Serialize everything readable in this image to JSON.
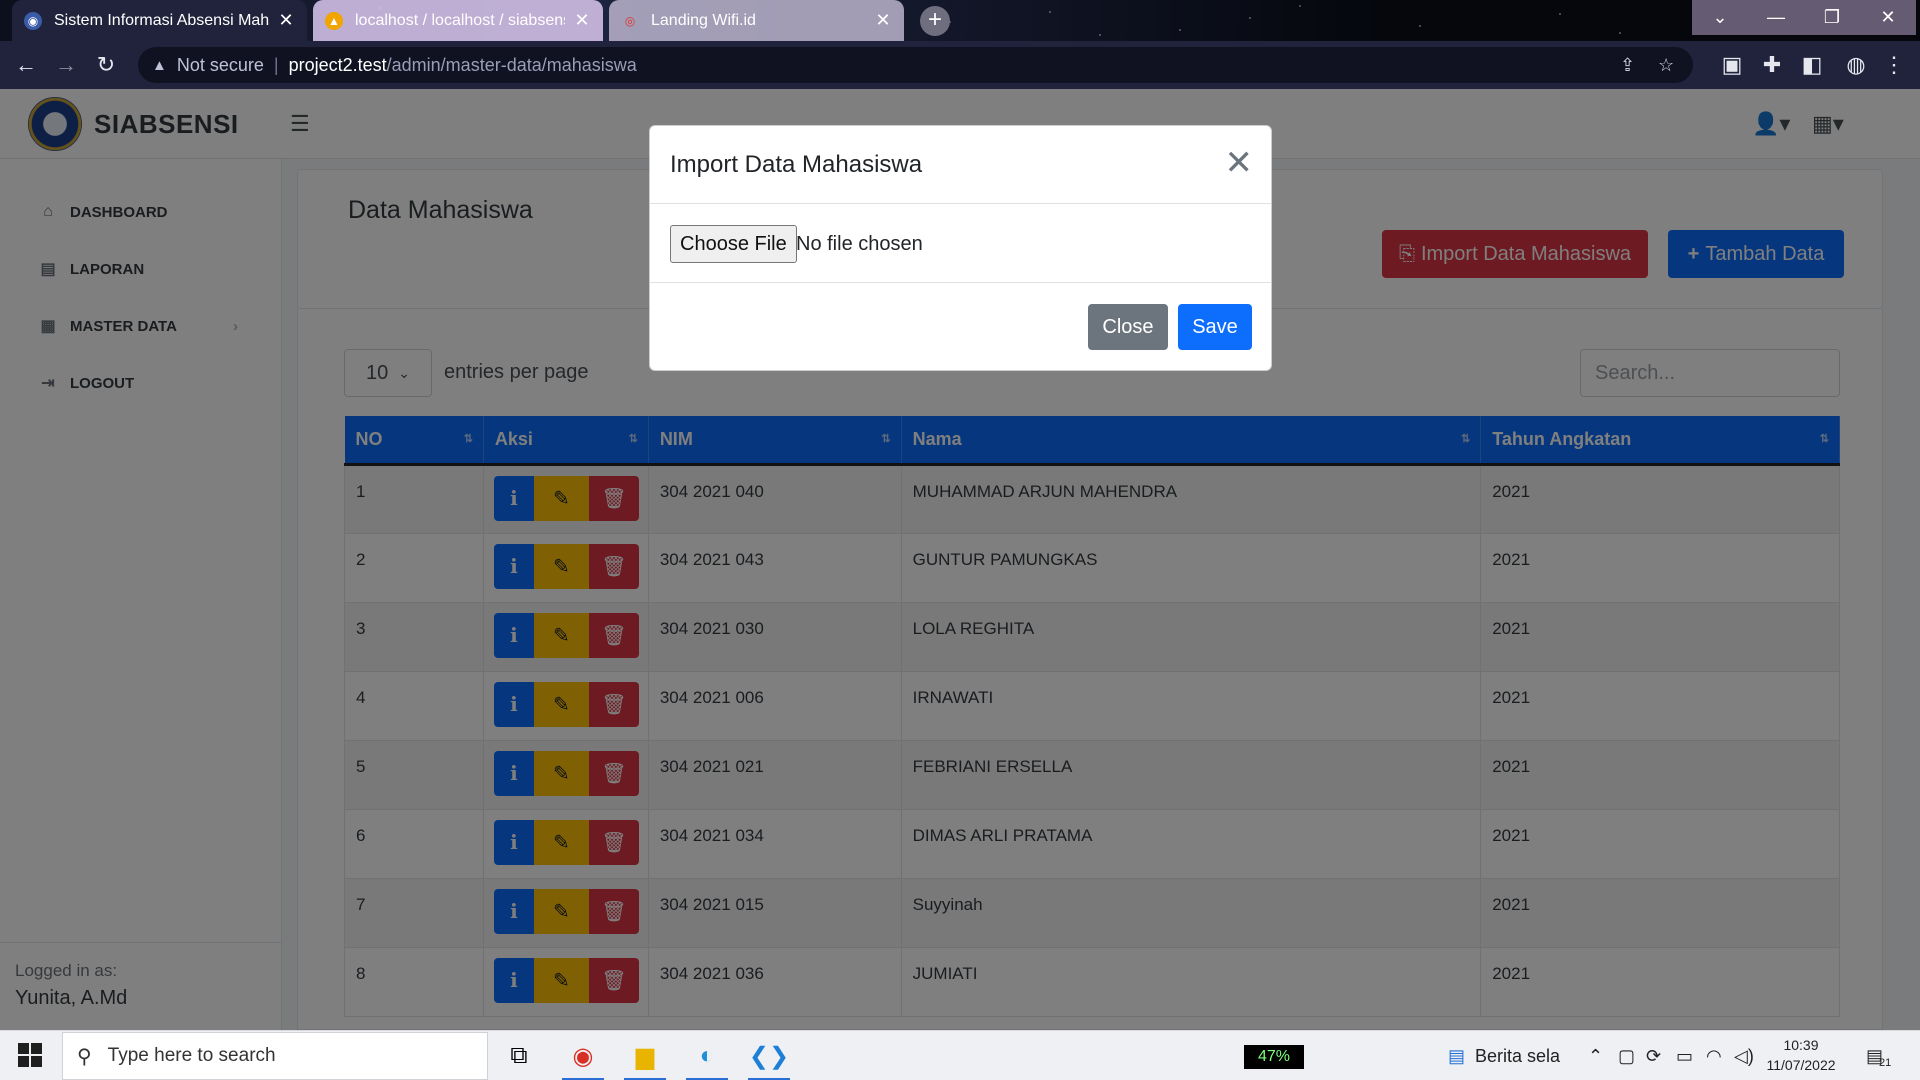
{
  "browser": {
    "tabs": [
      {
        "title": "Sistem Informasi Absensi Mahasi"
      },
      {
        "title": "localhost / localhost / siabsensi"
      },
      {
        "title": "Landing Wifi.id"
      }
    ],
    "address": {
      "security": "Not secure",
      "host": "project2.test",
      "path": "/admin/master-data/mahasiswa"
    }
  },
  "app": {
    "brand": "SIABSENSI",
    "sidebar": {
      "items": [
        {
          "label": "DASHBOARD",
          "icon": "home-icon"
        },
        {
          "label": "LAPORAN",
          "icon": "report-icon"
        },
        {
          "label": "MASTER DATA",
          "icon": "table-icon"
        },
        {
          "label": "LOGOUT",
          "icon": "logout-icon"
        }
      ],
      "footer": {
        "label": "Logged in as:",
        "user": "Yunita, A.Md"
      }
    },
    "page_title": "Data Mahasiswa",
    "buttons": {
      "import": "Import Data Mahasiswa",
      "add": "Tambah Data"
    },
    "table": {
      "per_page": "10",
      "per_page_label": "entries per page",
      "search_placeholder": "Search...",
      "columns": [
        "NO",
        "Aksi",
        "NIM",
        "Nama",
        "Tahun Angkatan"
      ],
      "rows": [
        {
          "no": "1",
          "nim": "304 2021 040",
          "nama": "MUHAMMAD ARJUN MAHENDRA",
          "tahun": "2021"
        },
        {
          "no": "2",
          "nim": "304 2021 043",
          "nama": "GUNTUR PAMUNGKAS",
          "tahun": "2021"
        },
        {
          "no": "3",
          "nim": "304 2021 030",
          "nama": "LOLA REGHITA",
          "tahun": "2021"
        },
        {
          "no": "4",
          "nim": "304 2021 006",
          "nama": "IRNAWATI",
          "tahun": "2021"
        },
        {
          "no": "5",
          "nim": "304 2021 021",
          "nama": "FEBRIANI ERSELLA",
          "tahun": "2021"
        },
        {
          "no": "6",
          "nim": "304 2021 034",
          "nama": "DIMAS ARLI PRATAMA",
          "tahun": "2021"
        },
        {
          "no": "7",
          "nim": "304 2021 015",
          "nama": "Suyyinah",
          "tahun": "2021"
        },
        {
          "no": "8",
          "nim": "304 2021 036",
          "nama": "JUMIATI",
          "tahun": "2021"
        }
      ]
    }
  },
  "modal": {
    "title": "Import Data Mahasiswa",
    "file_button": "Choose File",
    "file_status": "No file chosen",
    "close_label": "Close",
    "save_label": "Save"
  },
  "taskbar": {
    "search_placeholder": "Type here to search",
    "battery": "47%",
    "news": "Berita sela",
    "time": "10:39",
    "date": "11/07/2022",
    "notifications": "21"
  },
  "colors": {
    "primary": "#0d6efd",
    "danger": "#dc3545",
    "warning": "#ffc107",
    "secondary": "#6c757d"
  }
}
